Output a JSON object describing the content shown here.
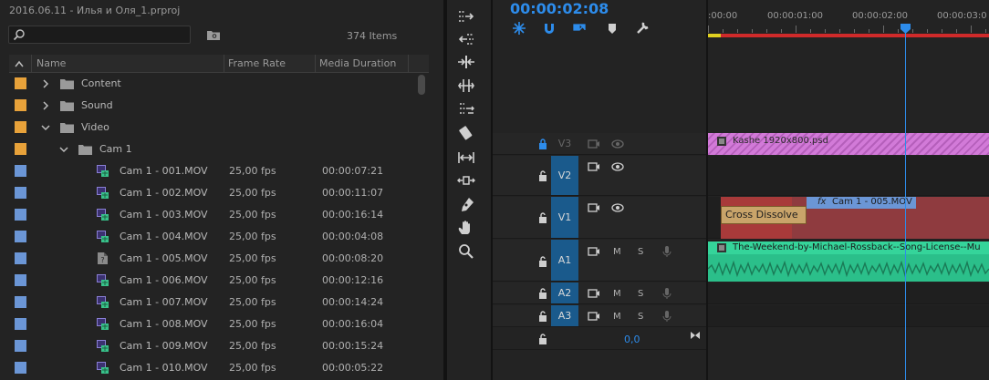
{
  "project": {
    "title": "2016.06.11 - Илья и Оля_1.prproj",
    "items_count": "374 Items",
    "columns": [
      "Name",
      "Frame Rate",
      "Media Duration"
    ],
    "rows": [
      {
        "type": "folder",
        "label": "Content",
        "expanded": false,
        "color": "#e8a23a",
        "indent": 0
      },
      {
        "type": "folder",
        "label": "Sound",
        "expanded": false,
        "color": "#e8a23a",
        "indent": 0
      },
      {
        "type": "folder",
        "label": "Video",
        "expanded": true,
        "color": "#e8a23a",
        "indent": 0
      },
      {
        "type": "folder",
        "label": "Cam 1",
        "expanded": true,
        "color": "#e8a23a",
        "indent": 1
      },
      {
        "type": "clip",
        "label": "Cam 1 - 001.MOV",
        "fps": "25,00 fps",
        "dur": "00:00:07:21",
        "color": "#6b96d6"
      },
      {
        "type": "clip",
        "label": "Cam 1 - 002.MOV",
        "fps": "25,00 fps",
        "dur": "00:00:11:07",
        "color": "#6b96d6"
      },
      {
        "type": "clip",
        "label": "Cam 1 - 003.MOV",
        "fps": "25,00 fps",
        "dur": "00:00:16:14",
        "color": "#6b96d6"
      },
      {
        "type": "clip",
        "label": "Cam 1 - 004.MOV",
        "fps": "25,00 fps",
        "dur": "00:00:04:08",
        "color": "#6b96d6"
      },
      {
        "type": "clip",
        "label": "Cam 1 - 005.MOV",
        "fps": "25,00 fps",
        "dur": "00:00:08:20",
        "color": "#6b96d6",
        "offline": true
      },
      {
        "type": "clip",
        "label": "Cam 1 - 006.MOV",
        "fps": "25,00 fps",
        "dur": "00:00:12:16",
        "color": "#6b96d6"
      },
      {
        "type": "clip",
        "label": "Cam 1 - 007.MOV",
        "fps": "25,00 fps",
        "dur": "00:00:14:24",
        "color": "#6b96d6"
      },
      {
        "type": "clip",
        "label": "Cam 1 - 008.MOV",
        "fps": "25,00 fps",
        "dur": "00:00:16:04",
        "color": "#6b96d6"
      },
      {
        "type": "clip",
        "label": "Cam 1 - 009.MOV",
        "fps": "25,00 fps",
        "dur": "00:00:15:24",
        "color": "#6b96d6"
      },
      {
        "type": "clip",
        "label": "Cam 1 - 010.MOV",
        "fps": "25,00 fps",
        "dur": "00:00:05:22",
        "color": "#6b96d6"
      }
    ]
  },
  "tools": [
    "track-select-forward-tool",
    "track-select-backward-tool",
    "ripple-edit-tool",
    "rolling-edit-tool",
    "rate-stretch-tool",
    "razor-tool",
    "slip-tool",
    "slide-tool",
    "pen-tool",
    "hand-tool",
    "zoom-tool"
  ],
  "timeline": {
    "timecode": "00:00:02:08",
    "ruler": [
      ":00:00",
      "00:00:01:00",
      "00:00:02:00",
      "00:00:03:0"
    ],
    "tracks": {
      "v3": "V3",
      "v2": "V2",
      "v1": "V1",
      "a1": "A1",
      "a2": "A2",
      "a3": "A3",
      "m": "M",
      "s": "S"
    },
    "clips": {
      "v3_clip": "Kashe 1920x800.psd",
      "v1_clip": "Cam 1 - 005.MOV",
      "transition": "Cross Dissolve",
      "fx_badge": "fx",
      "audio_clip": "The-Weekend-by-Michael-Rossback--Song-License--Mu"
    },
    "position_value": "0,0"
  },
  "colors": {
    "accent": "#2d8ceb",
    "track_label": "#1a5a8c",
    "video_clip": "#8f3b3f",
    "audio_clip": "#2bbf8a",
    "graphic_clip": "#d27ad8"
  }
}
